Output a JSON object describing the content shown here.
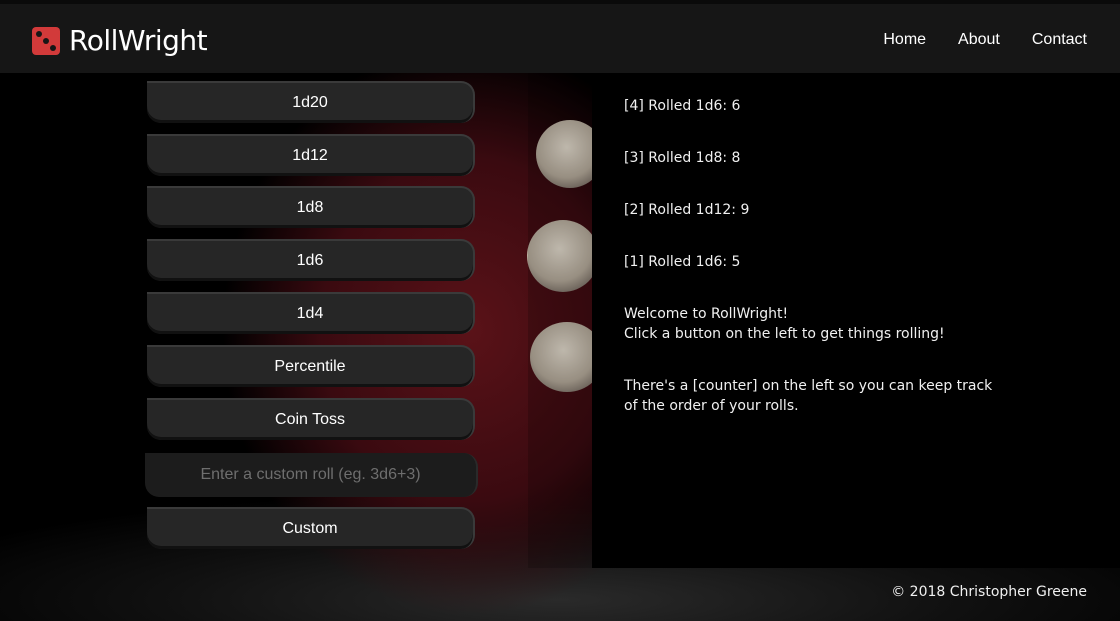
{
  "header": {
    "brand": "RollWright",
    "nav": [
      "Home",
      "About",
      "Contact"
    ]
  },
  "buttons": [
    "1d20",
    "1d12",
    "1d8",
    "1d6",
    "1d4",
    "Percentile",
    "Coin Toss"
  ],
  "custom": {
    "placeholder": "Enter a custom roll (eg. 3d6+3)",
    "button_label": "Custom"
  },
  "log": {
    "entries": [
      "[4] Rolled 1d6: 6",
      "[3] Rolled 1d8: 8",
      "[2] Rolled 1d12: 9",
      "[1] Rolled 1d6: 5"
    ],
    "welcome_line1": "Welcome to RollWright!",
    "welcome_line2": "Click a button on the left to get things rolling!",
    "counter_line1": "There's a [counter] on the left so you can keep track",
    "counter_line2": "of the order of your rolls."
  },
  "footer": {
    "copyright": "© 2018 Christopher Greene"
  },
  "colors": {
    "accent": "#d23a3a",
    "button_bg": "#262626",
    "topbar_bg": "#161616"
  }
}
